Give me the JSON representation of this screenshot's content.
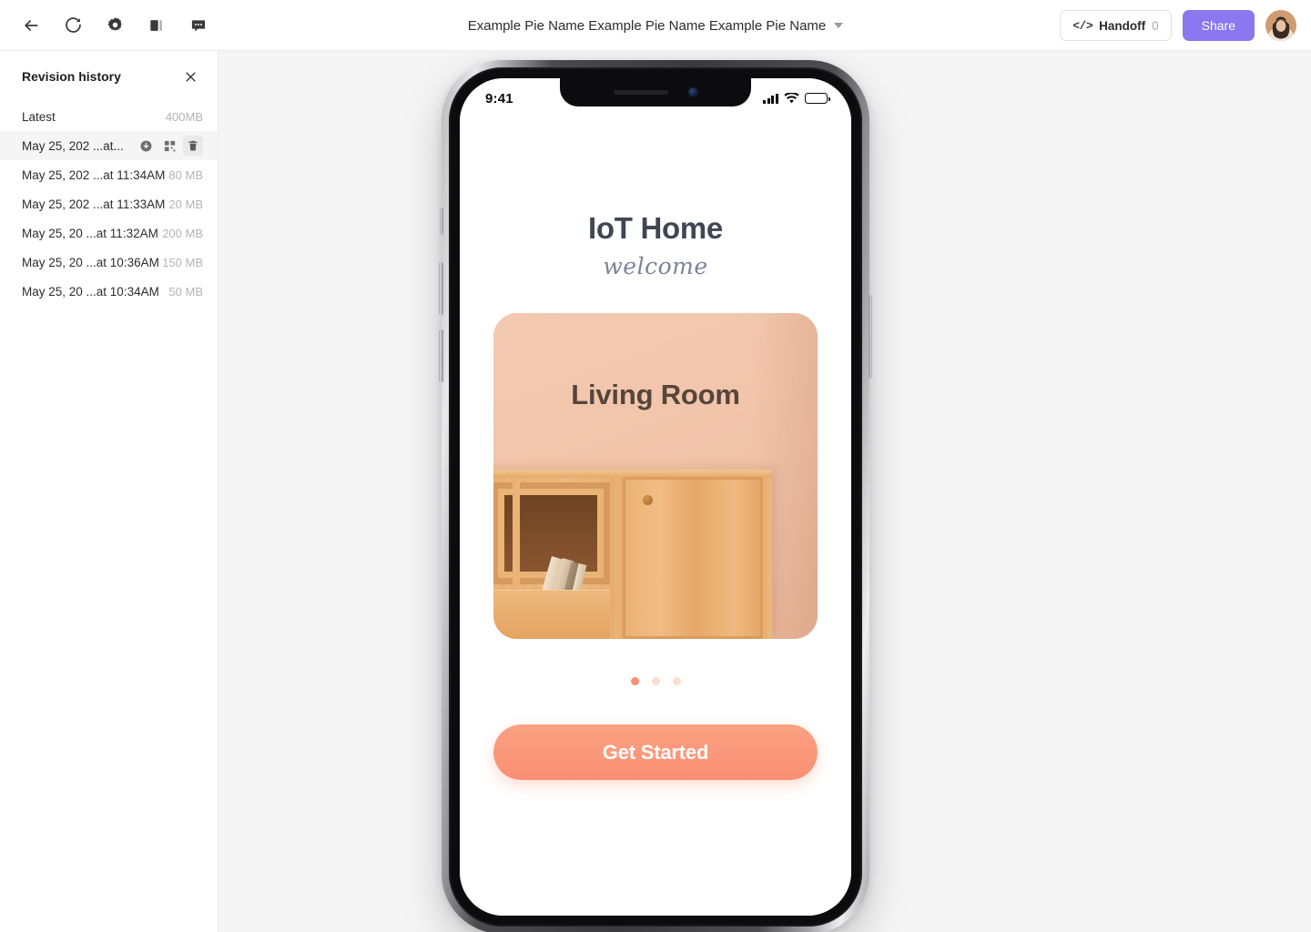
{
  "topbar": {
    "back_icon": "arrow-left-icon",
    "reload_icon": "refresh-icon",
    "settings_icon": "gear-icon",
    "panel_icon": "panel-toggle-icon",
    "comment_icon": "comment-icon",
    "title": "Example Pie Name Example Pie Name Example Pie Name",
    "handoff": {
      "code_glyph": "</>",
      "label": "Handoff",
      "count": "0"
    },
    "share_label": "Share",
    "avatar_name": "user-avatar",
    "accent_purple": "#8b77f0"
  },
  "sidebar": {
    "title": "Revision history",
    "close_icon": "close-icon",
    "revisions": [
      {
        "label": "Latest",
        "size": "400MB",
        "selected": false
      },
      {
        "label": "May 25, 202 ...at...",
        "size": "",
        "selected": true
      },
      {
        "label": "May 25, 202 ...at 11:34AM",
        "size": "80 MB",
        "selected": false
      },
      {
        "label": "May 25, 202 ...at 11:33AM",
        "size": "20 MB",
        "selected": false
      },
      {
        "label": "May 25, 20 ...at 11:32AM",
        "size": "200 MB",
        "selected": false
      },
      {
        "label": "May 25, 20 ...at 10:36AM",
        "size": "150 MB",
        "selected": false
      },
      {
        "label": "May 25, 20 ...at 10:34AM",
        "size": "50 MB",
        "selected": false
      }
    ],
    "row_actions": {
      "download_icon": "download-circle-icon",
      "restore_icon": "grid-squares-icon",
      "delete_icon": "trash-icon"
    }
  },
  "canvas": {
    "background": "#f5f5f5",
    "device": "iphone-mockup"
  },
  "phone": {
    "statusbar": {
      "time": "9:41",
      "signal_icon": "cellular-bars-icon",
      "wifi_icon": "wifi-icon",
      "battery_icon": "battery-icon"
    },
    "app": {
      "title": "IoT Home",
      "subtitle": "welcome",
      "card": {
        "room_label": "Living Room",
        "wall_color": "#f0c3a8",
        "wood_color": "#e8a868"
      },
      "pagination": {
        "count": 3,
        "active_index": 0,
        "active_color": "#f88f6e",
        "inactive_color": "#fbdfd1"
      },
      "cta_label": "Get Started",
      "cta_color": "#fa8f73"
    }
  }
}
